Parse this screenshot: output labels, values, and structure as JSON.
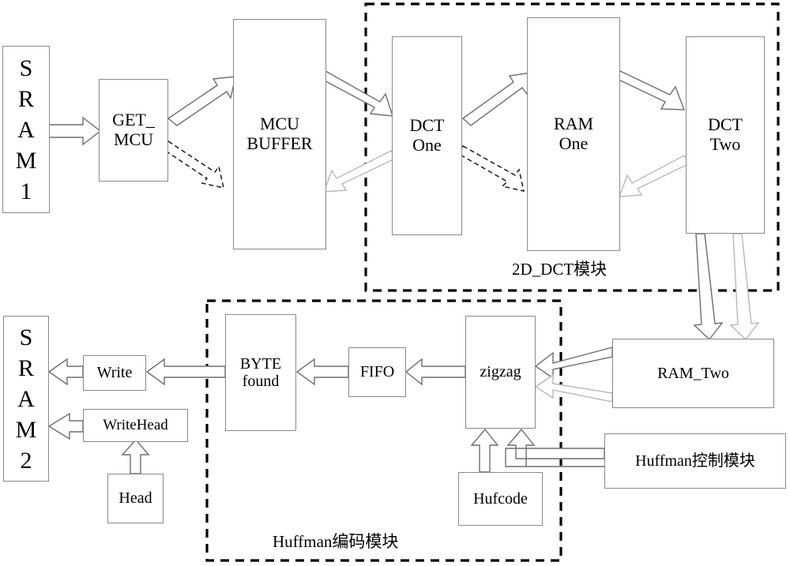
{
  "diagram": {
    "title": "JPEG encoder hardware block diagram",
    "colors": {
      "box_border": "#8a8a8a",
      "arrow_solid": "#6e6e6e",
      "arrow_faint": "#b8b8b8",
      "arrow_dashed": "#1a1a1a",
      "group_border": "#000000",
      "background": "#ffffff",
      "text": "#000000"
    },
    "nodes": [
      {
        "id": "sram1",
        "label": "SRAM1",
        "letters": [
          "S",
          "R",
          "A",
          "M",
          "1"
        ]
      },
      {
        "id": "get_mcu",
        "label": "GET_ MCU",
        "lines": [
          "GET_",
          "MCU"
        ]
      },
      {
        "id": "mcu_buffer",
        "label": "MCU BUFFER",
        "lines": [
          "MCU",
          "BUFFER"
        ]
      },
      {
        "id": "dct_one",
        "label": "DCT One",
        "lines": [
          "DCT",
          "One"
        ]
      },
      {
        "id": "ram_one",
        "label": "RAM One",
        "lines": [
          "RAM",
          "One"
        ]
      },
      {
        "id": "dct_two",
        "label": "DCT Two",
        "lines": [
          "DCT",
          "Two"
        ]
      },
      {
        "id": "ram_two",
        "label": "RAM_Two",
        "lines": [
          "RAM_Two"
        ]
      },
      {
        "id": "zigzag",
        "label": "zigzag",
        "lines": [
          "zigzag"
        ]
      },
      {
        "id": "fifo",
        "label": "FIFO",
        "lines": [
          "FIFO"
        ]
      },
      {
        "id": "byte_found",
        "label": "BYTE found",
        "lines": [
          "BYTE",
          "found"
        ]
      },
      {
        "id": "write",
        "label": "Write",
        "lines": [
          "Write"
        ]
      },
      {
        "id": "writehead",
        "label": "WriteHead",
        "lines": [
          "WriteHead"
        ]
      },
      {
        "id": "head",
        "label": "Head",
        "lines": [
          "Head"
        ]
      },
      {
        "id": "hufcode",
        "label": "Hufcode",
        "lines": [
          "Hufcode"
        ]
      },
      {
        "id": "huff_ctrl",
        "label": "Huffman控制模块",
        "lines": [
          "Huffman控制模块"
        ]
      },
      {
        "id": "sram2",
        "label": "SRAM2",
        "letters": [
          "S",
          "R",
          "A",
          "M",
          "2"
        ]
      }
    ],
    "labels": {
      "sram1_l1": "S",
      "sram1_l2": "R",
      "sram1_l3": "A",
      "sram1_l4": "M",
      "sram1_l5": "1",
      "sram2_l1": "S",
      "sram2_l2": "R",
      "sram2_l3": "A",
      "sram2_l4": "M",
      "sram2_l5": "2",
      "get_mcu_l1": "GET_",
      "get_mcu_l2": "MCU",
      "mcu_buffer_l1": "MCU",
      "mcu_buffer_l2": "BUFFER",
      "dct_one_l1": "DCT",
      "dct_one_l2": "One",
      "ram_one_l1": "RAM",
      "ram_one_l2": "One",
      "dct_two_l1": "DCT",
      "dct_two_l2": "Two",
      "ram_two": "RAM_Two",
      "zigzag": "zigzag",
      "fifo": "FIFO",
      "byte_found_l1": "BYTE",
      "byte_found_l2": "found",
      "write": "Write",
      "writehead": "WriteHead",
      "head": "Head",
      "hufcode": "Hufcode",
      "huff_ctrl": "Huffman控制模块"
    },
    "groups": [
      {
        "id": "dct_group",
        "label": "2D_DCT模块"
      },
      {
        "id": "huff_group",
        "label": "Huffman编码模块"
      }
    ],
    "group_labels": {
      "dct_group": "2D_DCT模块",
      "huff_group": "Huffman编码模块"
    }
  }
}
